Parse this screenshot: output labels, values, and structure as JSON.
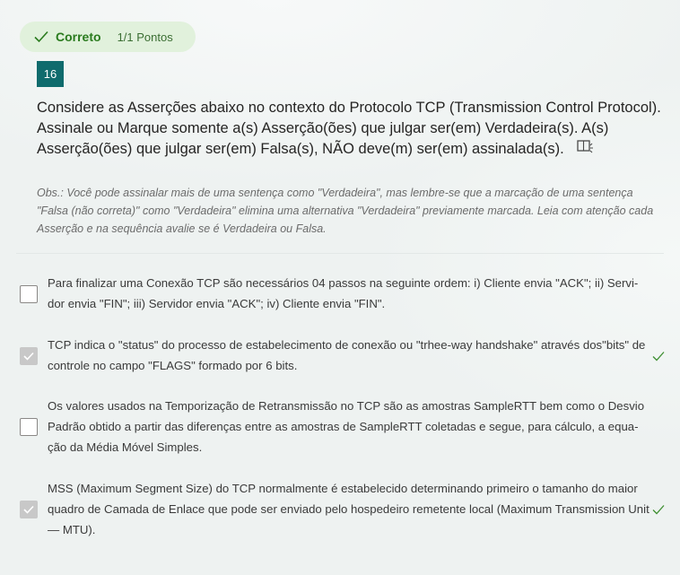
{
  "result": {
    "status": "Correto",
    "points": "1/1 Pontos",
    "icon": "check-icon",
    "color": "#2a7b1e"
  },
  "question": {
    "number": "16",
    "text": "Considere as Asserções abaixo no contexto do Protocolo TCP (Transmission Control Protocol). Assinale ou Marque somente a(s) Asserção(ões) que julgar ser(em) Verdadeira(s). A(s) Asserção(ões) que julgar ser(em) Falsa(s), NÃO deve(m) ser(em) assinalada(s).",
    "icon": "immersive-reader-icon",
    "note": "Obs.: Você pode assinalar mais de uma sentença como \"Verdadeira\", mas lembre-se que a marcação de uma sentença \"Falsa (não correta)\" como \"Verdadeira\" elimina uma alternativa \"Verdadeira\" previamente marcada. Leia com atenção cada Asserção e na sequência avalie se é Verdadeira ou Falsa."
  },
  "options": [
    {
      "text": "Para finalizar uma Conexão TCP são necessários 04 passos na seguinte ordem: i) Cliente envia \"ACK\"; ii) Servi-dor envia \"FIN\"; iii) Servidor envia \"ACK\"; iv) Cliente envia \"FIN\".",
      "checked": false,
      "correct": false
    },
    {
      "text": "TCP indica o \"status\" do processo de estabelecimento de conexão ou \"trhee-way handshake\" através dos\"bits\" de controle no campo \"FLAGS\" formado por 6 bits.",
      "checked": true,
      "correct": true
    },
    {
      "text": "Os valores usados na Temporização de Retransmissão no TCP são as amostras SampleRTT bem como o Desvio Padrão obtido a partir das diferenças entre as amostras de SampleRTT coletadas e segue, para cálculo, a equa-ção da Média Móvel Simples.",
      "checked": false,
      "correct": false
    },
    {
      "text": "MSS (Maximum Segment Size) do TCP normalmente é estabelecido determinando primeiro o tamanho do maior quadro de Camada de Enlace que pode ser enviado pelo hospedeiro remetente local (Maximum Transmission Unit — MTU).",
      "checked": true,
      "correct": true
    }
  ]
}
